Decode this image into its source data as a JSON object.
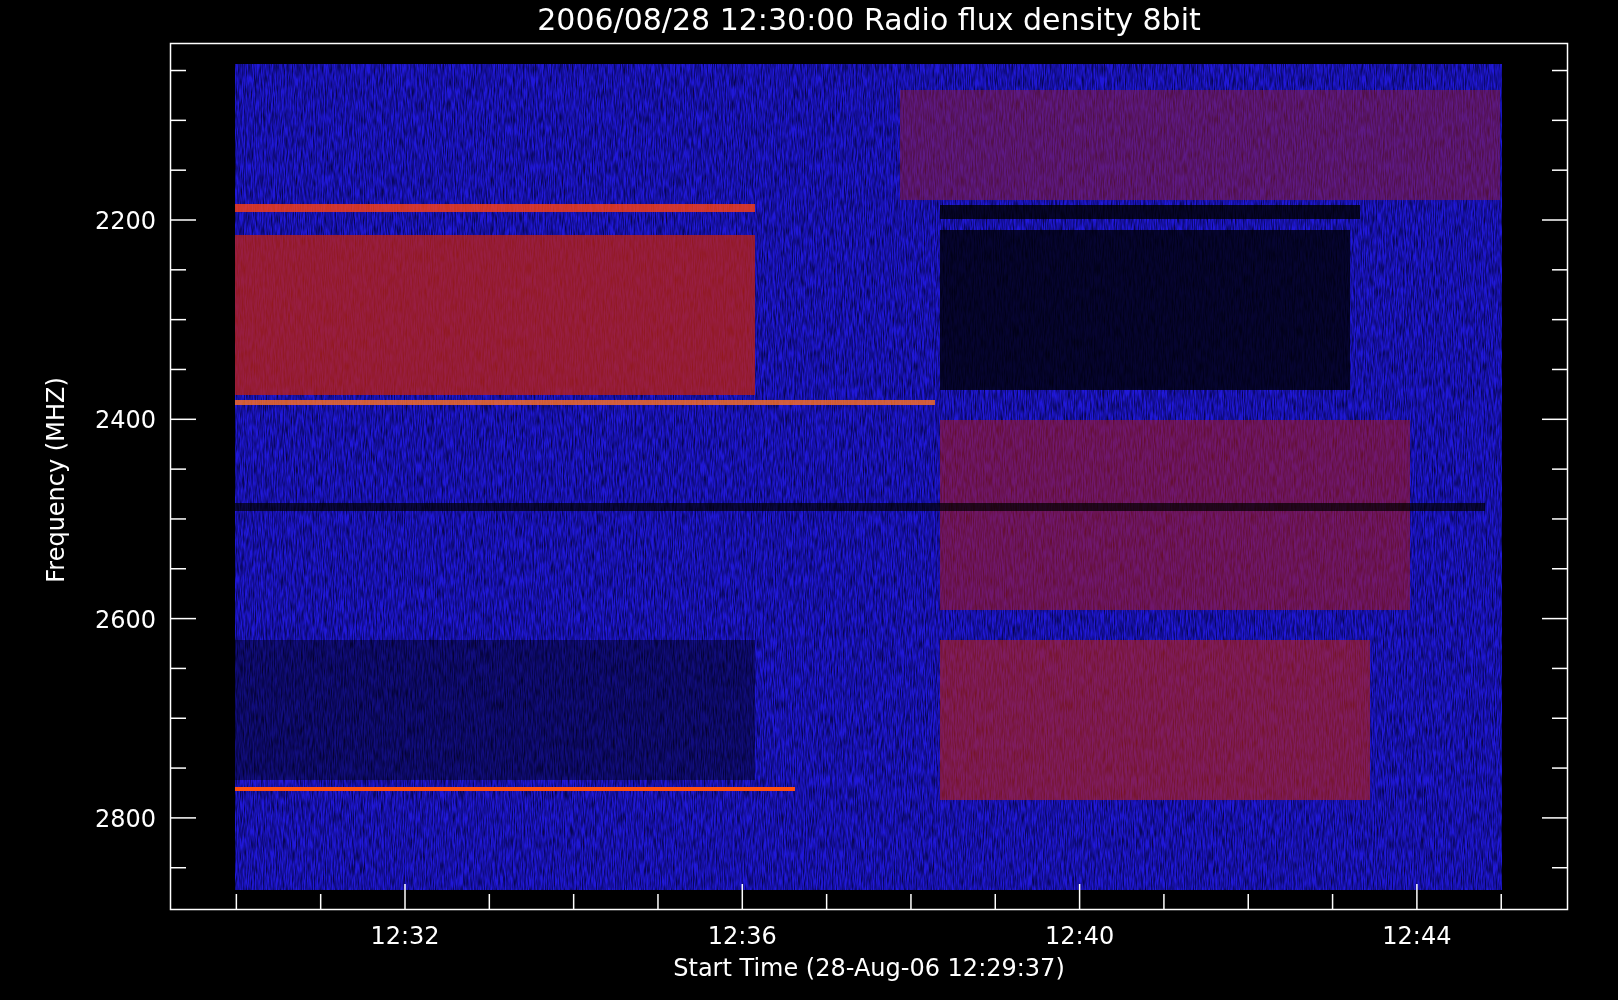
{
  "title": "2006/08/28 12:30:00 Radio flux density 8bit",
  "y_axis": {
    "label": "Frequency (MHZ)",
    "ticks": [
      "2200",
      "2400",
      "2600",
      "2800"
    ]
  },
  "x_axis": {
    "label": "Start Time (28-Aug-06 12:29:37)",
    "ticks": [
      "12:32",
      "12:36",
      "12:40",
      "12:44"
    ]
  }
}
